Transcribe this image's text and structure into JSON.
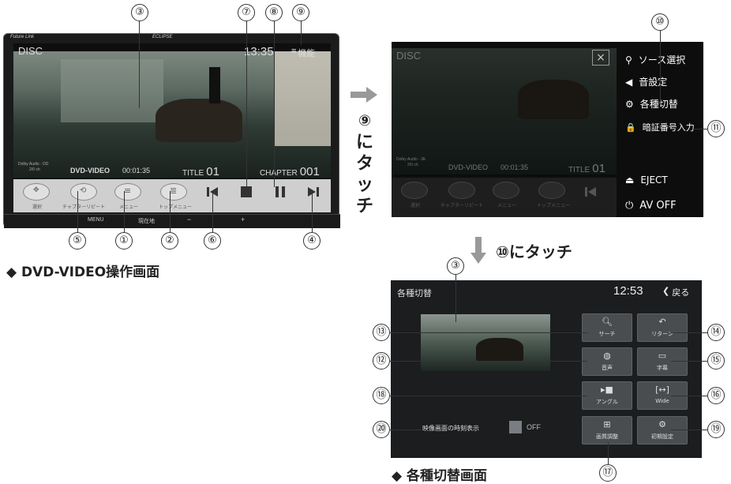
{
  "screen1": {
    "brand_left": "Future Link",
    "brand_center": "ECLIPSE",
    "source": "DISC",
    "clock": "13:35",
    "menu_label": "機能",
    "audio_info_1": "Dolby Audio - DD",
    "audio_info_2": "2/0 ch",
    "format": "DVD-VIDEO",
    "elapsed": "00:01:35",
    "title_label": "TITLE",
    "title_num": "01",
    "chapter_label": "CHAPTER",
    "chapter_num": "001",
    "buttons": [
      "選択",
      "チャプターリピート",
      "メニュー",
      "トップメニュー"
    ],
    "hw_menu": "MENU",
    "hw_location": "現在地",
    "hw_minus": "−",
    "hw_plus": "+",
    "caption": "◆ DVD-VIDEO操作画面"
  },
  "screen2": {
    "source": "DISC",
    "close_icon": "×",
    "menu": [
      "ソース選択",
      "音設定",
      "各種切替",
      "暗証番号入力"
    ],
    "eject": "EJECT",
    "av_off": "AV OFF",
    "audio_info_1": "Dolby Audio - 3E",
    "audio_info_2": "2/0 ch",
    "format": "DVD-VIDEO",
    "elapsed": "00:01:35",
    "title_label": "TITLE",
    "title_num": "01",
    "buttons": [
      "選択",
      "チャプターリピート",
      "メニュー",
      "トップメニュー"
    ]
  },
  "arrow_text": "⑨にタッチ",
  "arrow_text_chars": [
    "⑨",
    "に",
    "タ",
    "ッ",
    "チ"
  ],
  "down_text": "⑩にタッチ",
  "screen3": {
    "title": "各種切替",
    "clock": "12:53",
    "back": "戻る",
    "tiles": [
      "サーチ",
      "リターン",
      "音声",
      "字幕",
      "アングル",
      "Wide",
      "画質調整",
      "初期設定"
    ],
    "toggle_label": "映像画面の時刻表示",
    "toggle_value": "OFF",
    "caption": "◆ 各種切替画面"
  },
  "callouts": [
    "①",
    "②",
    "③",
    "④",
    "⑤",
    "⑥",
    "⑦",
    "⑧",
    "⑨",
    "⑩",
    "⑪",
    "⑫",
    "⑬",
    "⑭",
    "⑮",
    "⑯",
    "⑰",
    "⑱",
    "⑲",
    "⑳"
  ]
}
